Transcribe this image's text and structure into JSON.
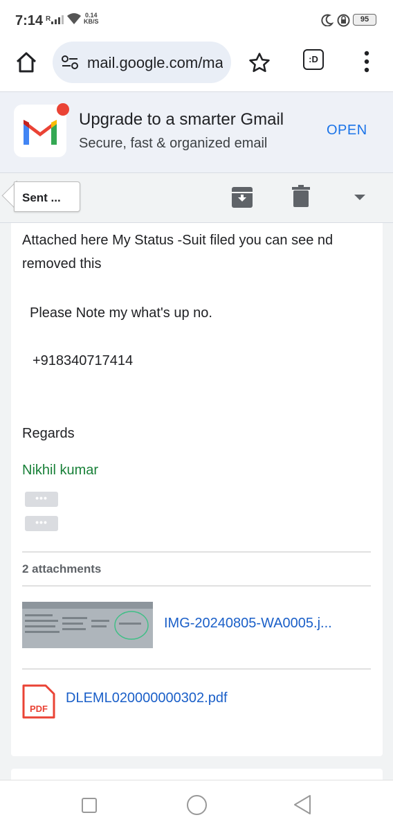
{
  "status_bar": {
    "time": "7:14",
    "signal_label": "R",
    "speed_value": "0.14",
    "speed_unit": "KB/S",
    "battery": "95"
  },
  "browser": {
    "url": "mail.google.com/mail",
    "tabs_label": ":D"
  },
  "promo": {
    "title": "Upgrade to a smarter Gmail",
    "subtitle": "Secure, fast & organized email",
    "open_label": "OPEN",
    "colors": {
      "red": "#ea4335",
      "blue": "#4285f4",
      "green": "#34a853",
      "yellow": "#fbbc04"
    }
  },
  "toolbar": {
    "back_label": "Sent ..."
  },
  "email": {
    "line1": "Attached here My Status -Suit filed you can see nd",
    "line2": "removed this",
    "line3": "Please Note my what's up no.",
    "phone": "+918340717414",
    "regards": "Regards",
    "signature": "Nikhil kumar",
    "ellipsis": "•••"
  },
  "attachments": {
    "header": "2 attachments",
    "items": [
      {
        "name": "IMG-20240805-WA0005.j..."
      },
      {
        "name": "DLEML020000000302.pdf",
        "type_label": "PDF"
      }
    ]
  },
  "colors": {
    "link": "#1a5fc8",
    "signature": "#188038",
    "accent": "#1a73e8"
  }
}
